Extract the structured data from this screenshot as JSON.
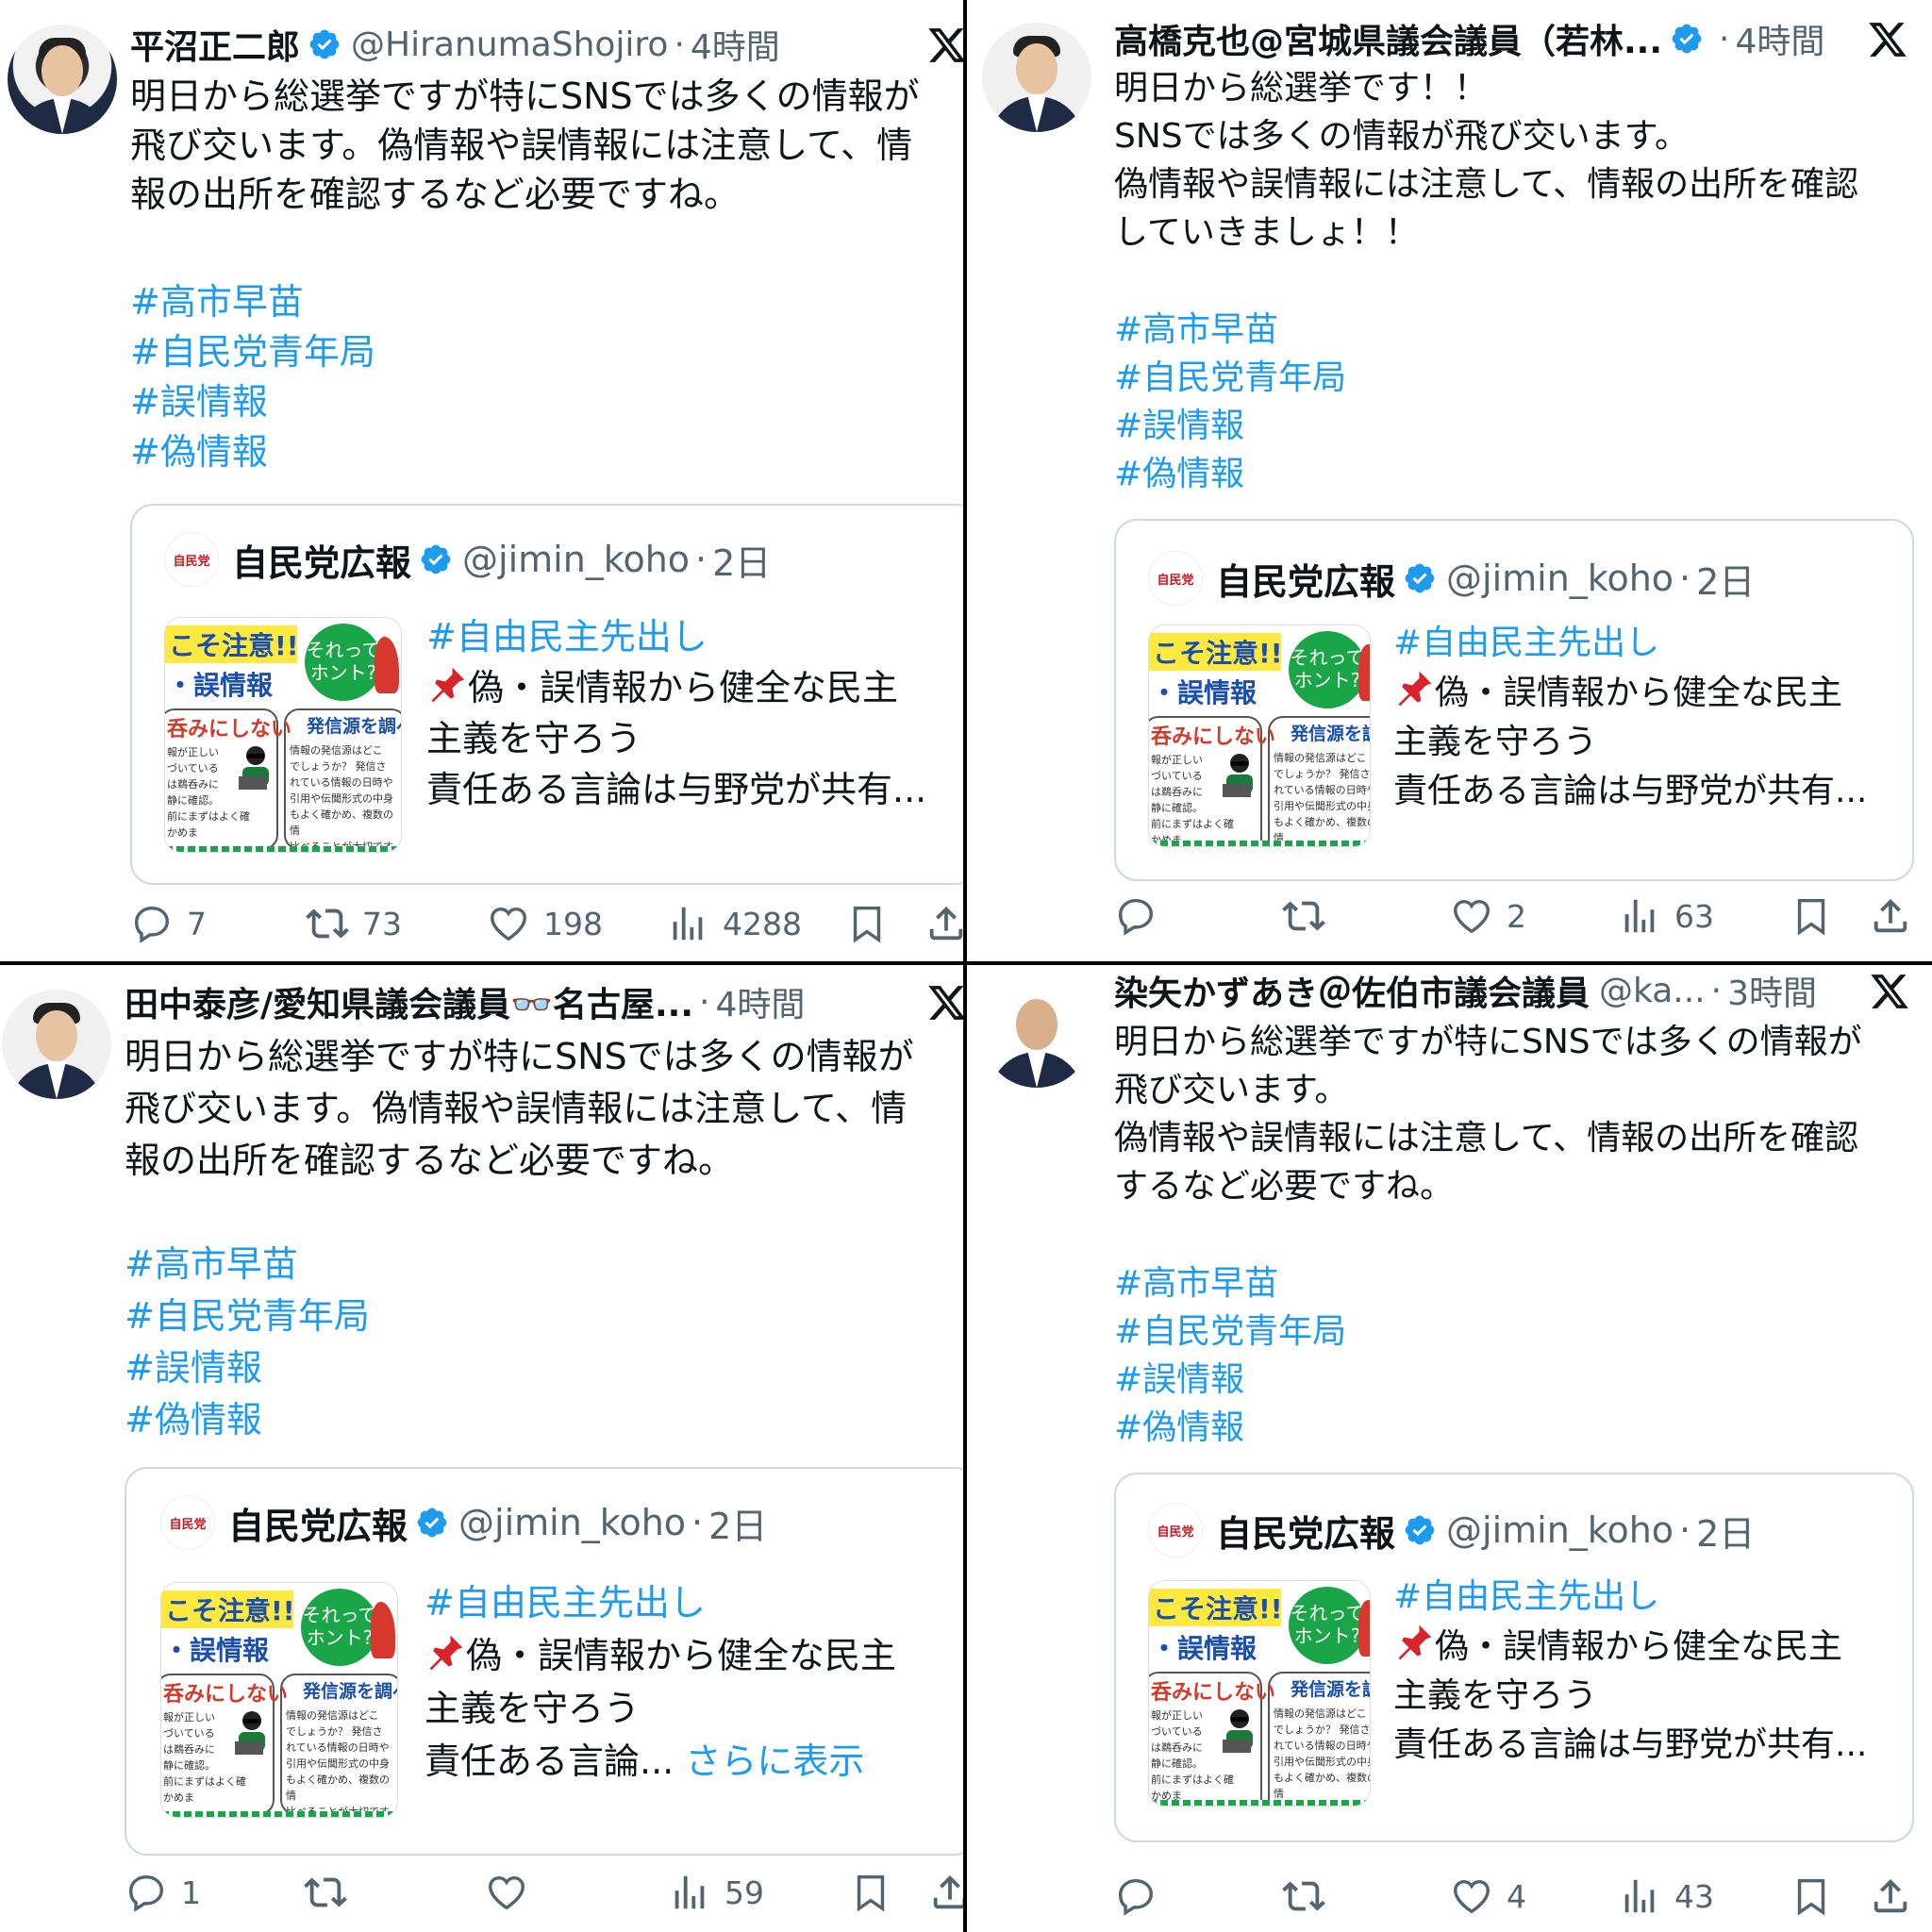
{
  "tweets": [
    {
      "author_name": "平沼正二郎",
      "handle": "@HiranumaShojiro",
      "time": "4時間",
      "body": "明日から総選挙ですが特にSNSでは多くの情報が\n飛び交います。偽情報や誤情報には注意して、情\n報の出所を確認するなど必要ですね。",
      "hashtags": [
        "#高市早苗",
        "#自民党青年局",
        "#誤情報",
        "#偽情報"
      ],
      "quote": {
        "name": "自民党広報",
        "handle": "@jimin_koho",
        "time": "2日",
        "line1": "#自由民主先出し",
        "line2": "偽・誤情報から健全な民主",
        "line3": "主義を守ろう",
        "line4": "責任ある言論は与野党が共有...",
        "more": ""
      },
      "replies": "7",
      "reposts": "73",
      "likes": "198",
      "views": "4288"
    },
    {
      "author_name": "高橋克也@宮城県議会議員（若林...",
      "handle": "",
      "time": "4時間",
      "body": "明日から総選挙です！！\nSNSでは多くの情報が飛び交います。\n偽情報や誤情報には注意して、情報の出所を確認\nしていきましょ！！",
      "hashtags": [
        "#高市早苗",
        "#自民党青年局",
        "#誤情報",
        "#偽情報"
      ],
      "quote": {
        "name": "自民党広報",
        "handle": "@jimin_koho",
        "time": "2日",
        "line1": "#自由民主先出し",
        "line2": "偽・誤情報から健全な民主",
        "line3": "主義を守ろう",
        "line4": "責任ある言論は与野党が共有...",
        "more": ""
      },
      "replies": "",
      "reposts": "",
      "likes": "2",
      "views": "63"
    },
    {
      "author_name": "田中泰彦/愛知県議会議員👓名古屋...",
      "handle": "",
      "time": "4時間",
      "body": "明日から総選挙ですが特にSNSでは多くの情報が\n飛び交います。偽情報や誤情報には注意して、情\n報の出所を確認するなど必要ですね。",
      "hashtags": [
        "#高市早苗",
        "#自民党青年局",
        "#誤情報",
        "#偽情報"
      ],
      "quote": {
        "name": "自民党広報",
        "handle": "@jimin_koho",
        "time": "2日",
        "line1": "#自由民主先出し",
        "line2": "偽・誤情報から健全な民主",
        "line3": "主義を守ろう",
        "line4": "責任ある言論...",
        "more": "さらに表示"
      },
      "replies": "1",
      "reposts": "",
      "likes": "",
      "views": "59"
    },
    {
      "author_name": "染矢かずあき＠佐伯市議会議員",
      "handle": "@ka...",
      "time": "3時間",
      "body": "明日から総選挙ですが特にSNSでは多くの情報が\n飛び交います。\n偽情報や誤情報には注意して、情報の出所を確認\nするなど必要ですね。",
      "hashtags": [
        "#高市早苗",
        "#自民党青年局",
        "#誤情報",
        "#偽情報"
      ],
      "quote": {
        "name": "自民党広報",
        "handle": "@jimin_koho",
        "time": "2日",
        "line1": "#自由民主先出し",
        "line2": "偽・誤情報から健全な民主",
        "line3": "主義を守ろう",
        "line4": "責任ある言論は与野党が共有...",
        "more": ""
      },
      "replies": "",
      "reposts": "",
      "likes": "4",
      "views": "43"
    }
  ],
  "thumbnail": {
    "t1": "こそ注意!!",
    "t2": "・誤情報",
    "bubble": "それって\nホント?",
    "box1_head": "呑みにしない",
    "box1_text": "報が正しい\nづいている\nは鵜呑みに\n静に確認。\n前にまずはよく確かめま",
    "box2_head": "発信源を調べ",
    "box2_text": "情報の発信源はどこ\nでしょうか？ 発信さ\nれている情報の日時や\n引用や伝聞形式の中身\nもよく確かめ、複数の情\n比べることが大切です",
    "logo_text": "自民党"
  },
  "colors": {
    "link": "#1d9bf0",
    "muted": "#536471",
    "border": "#cfd9de",
    "verified": "#1d9bf0"
  },
  "icons": [
    "verified-badge-icon",
    "x-logo-icon",
    "pushpin-icon",
    "reply-icon",
    "repost-icon",
    "like-icon",
    "views-icon",
    "bookmark-icon",
    "share-icon"
  ]
}
